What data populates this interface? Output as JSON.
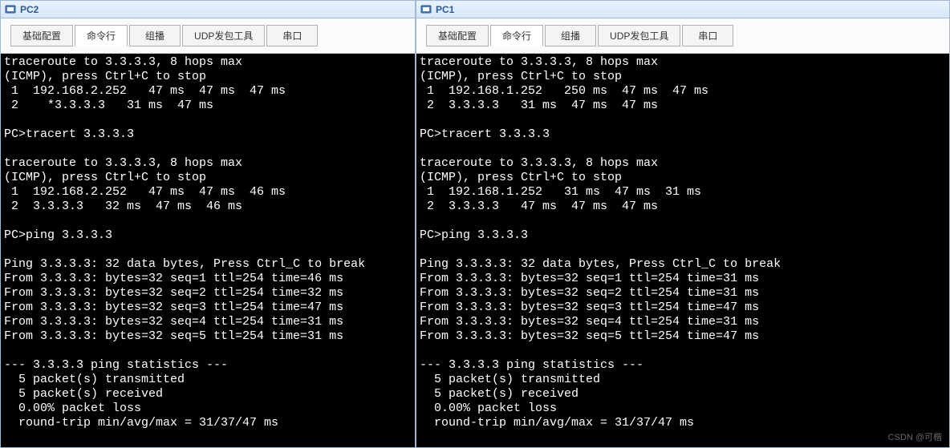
{
  "watermark": "CSDN @可楷",
  "left": {
    "title": "PC2",
    "tabs": [
      {
        "label": "基础配置",
        "active": false
      },
      {
        "label": "命令行",
        "active": true
      },
      {
        "label": "组播",
        "active": false
      },
      {
        "label": "UDP发包工具",
        "active": false
      },
      {
        "label": "串口",
        "active": false
      }
    ],
    "terminal": "traceroute to 3.3.3.3, 8 hops max\n(ICMP), press Ctrl+C to stop\n 1  192.168.2.252   47 ms  47 ms  47 ms\n 2    *3.3.3.3   31 ms  47 ms\n\nPC>tracert 3.3.3.3\n\ntraceroute to 3.3.3.3, 8 hops max\n(ICMP), press Ctrl+C to stop\n 1  192.168.2.252   47 ms  47 ms  46 ms\n 2  3.3.3.3   32 ms  47 ms  46 ms\n\nPC>ping 3.3.3.3\n\nPing 3.3.3.3: 32 data bytes, Press Ctrl_C to break\nFrom 3.3.3.3: bytes=32 seq=1 ttl=254 time=46 ms\nFrom 3.3.3.3: bytes=32 seq=2 ttl=254 time=32 ms\nFrom 3.3.3.3: bytes=32 seq=3 ttl=254 time=47 ms\nFrom 3.3.3.3: bytes=32 seq=4 ttl=254 time=31 ms\nFrom 3.3.3.3: bytes=32 seq=5 ttl=254 time=31 ms\n\n--- 3.3.3.3 ping statistics ---\n  5 packet(s) transmitted\n  5 packet(s) received\n  0.00% packet loss\n  round-trip min/avg/max = 31/37/47 ms"
  },
  "right": {
    "title": "PC1",
    "tabs": [
      {
        "label": "基础配置",
        "active": false
      },
      {
        "label": "命令行",
        "active": true
      },
      {
        "label": "组播",
        "active": false
      },
      {
        "label": "UDP发包工具",
        "active": false
      },
      {
        "label": "串口",
        "active": false
      }
    ],
    "terminal": "traceroute to 3.3.3.3, 8 hops max\n(ICMP), press Ctrl+C to stop\n 1  192.168.1.252   250 ms  47 ms  47 ms\n 2  3.3.3.3   31 ms  47 ms  47 ms\n\nPC>tracert 3.3.3.3\n\ntraceroute to 3.3.3.3, 8 hops max\n(ICMP), press Ctrl+C to stop\n 1  192.168.1.252   31 ms  47 ms  31 ms\n 2  3.3.3.3   47 ms  47 ms  47 ms\n\nPC>ping 3.3.3.3\n\nPing 3.3.3.3: 32 data bytes, Press Ctrl_C to break\nFrom 3.3.3.3: bytes=32 seq=1 ttl=254 time=31 ms\nFrom 3.3.3.3: bytes=32 seq=2 ttl=254 time=31 ms\nFrom 3.3.3.3: bytes=32 seq=3 ttl=254 time=47 ms\nFrom 3.3.3.3: bytes=32 seq=4 ttl=254 time=31 ms\nFrom 3.3.3.3: bytes=32 seq=5 ttl=254 time=47 ms\n\n--- 3.3.3.3 ping statistics ---\n  5 packet(s) transmitted\n  5 packet(s) received\n  0.00% packet loss\n  round-trip min/avg/max = 31/37/47 ms"
  }
}
